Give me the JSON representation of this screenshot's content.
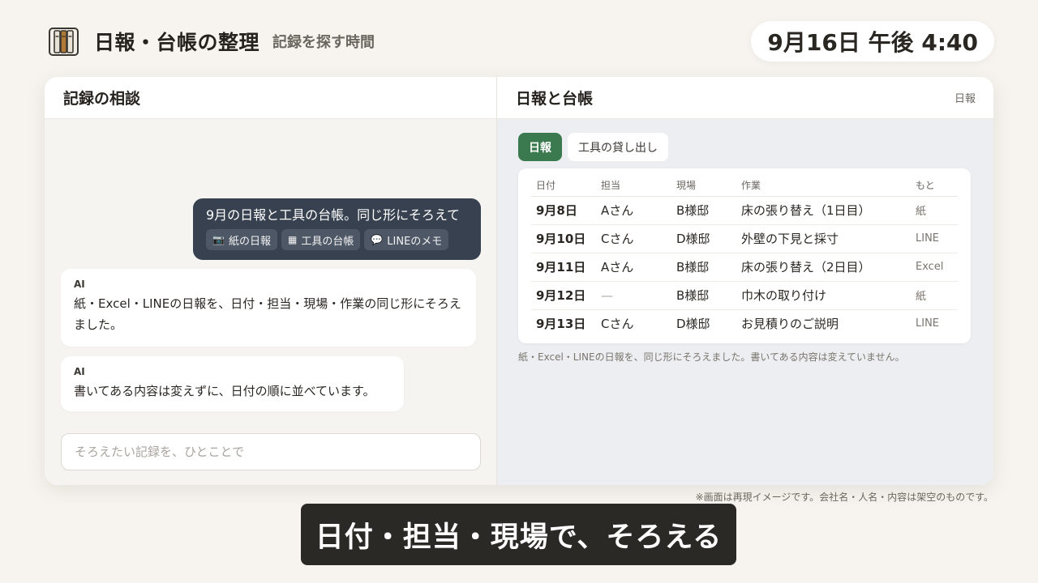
{
  "header": {
    "title": "日報・台帳の整理",
    "subtitle": "記録を探す時間",
    "clock": "9月16日 午後 4:40",
    "logo_icon": "binder-icon"
  },
  "left_panel": {
    "title": "記録の相談",
    "user_message": {
      "text": "9月の日報と工具の台帳。同じ形にそろえて",
      "attachments": [
        {
          "icon": "camera-icon",
          "glyph": "📷",
          "label": "紙の日報"
        },
        {
          "icon": "spreadsheet-icon",
          "glyph": "▦",
          "label": "工具の台帳"
        },
        {
          "icon": "chat-bubble-icon",
          "glyph": "💬",
          "label": "LINEのメモ"
        }
      ]
    },
    "ai_messages": [
      {
        "label": "AI",
        "text": "紙・Excel・LINEの日報を、日付・担当・現場・作業の同じ形にそろえました。"
      },
      {
        "label": "AI",
        "text": "書いてある内容は変えずに、日付の順に並べています。"
      }
    ],
    "input": {
      "placeholder": "そろえたい記録を、ひとことで",
      "value": ""
    }
  },
  "right_panel": {
    "title": "日報と台帳",
    "tag": "日報",
    "tabs": [
      {
        "label": "日報",
        "active": true
      },
      {
        "label": "工具の貸し出し",
        "active": false
      }
    ],
    "table": {
      "headers": [
        "日付",
        "担当",
        "現場",
        "作業",
        "もと"
      ],
      "rows": [
        [
          "9月8日",
          "Aさん",
          "B様邸",
          "床の張り替え（1日目）",
          "紙"
        ],
        [
          "9月10日",
          "Cさん",
          "D様邸",
          "外壁の下見と採寸",
          "LINE"
        ],
        [
          "9月11日",
          "Aさん",
          "B様邸",
          "床の張り替え（2日目）",
          "Excel"
        ],
        [
          "9月12日",
          "—",
          "B様邸",
          "巾木の取り付け",
          "紙"
        ],
        [
          "9月13日",
          "Cさん",
          "D様邸",
          "お見積りのご説明",
          "LINE"
        ]
      ]
    },
    "note": "紙・Excel・LINEの日報を、同じ形にそろえました。書いてある内容は変えていません。"
  },
  "disclaimer": "※画面は再現イメージです。会社名・人名・内容は架空のものです。",
  "caption": "日付・担当・現場で、そろえる",
  "colors": {
    "accent_green": "#3a7a4e",
    "user_bubble": "#37414f",
    "caption_bg": "#2b2926",
    "page_bg": "#f7f4ef"
  }
}
